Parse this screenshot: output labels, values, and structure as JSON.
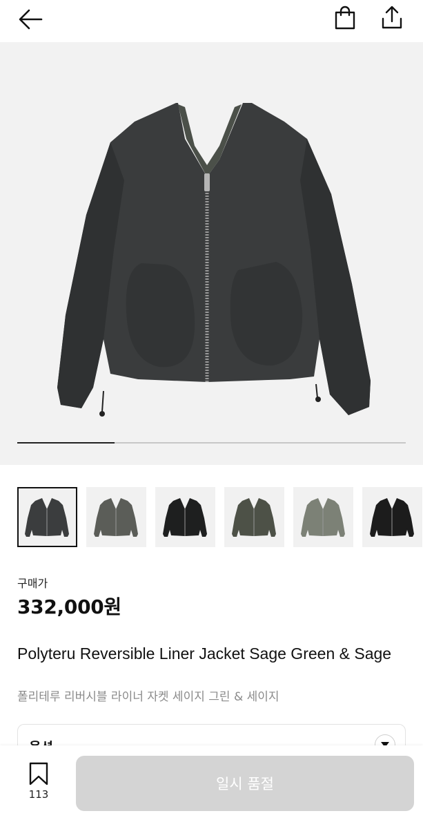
{
  "header": {
    "back_icon": "arrow-left-icon",
    "bag_icon": "shopping-bag-icon",
    "share_icon": "share-icon"
  },
  "gallery": {
    "progress": 0.25,
    "thumbnails": [
      {
        "name": "thumbnail-1",
        "selected": true,
        "jacket_color": "#3b3d3e"
      },
      {
        "name": "thumbnail-2",
        "selected": false,
        "jacket_color": "#5b5d58"
      },
      {
        "name": "thumbnail-3",
        "selected": false,
        "jacket_color": "#1e1f1f"
      },
      {
        "name": "thumbnail-4",
        "selected": false,
        "jacket_color": "#4d5147"
      },
      {
        "name": "thumbnail-5",
        "selected": false,
        "jacket_color": "#7c8176"
      },
      {
        "name": "thumbnail-6",
        "selected": false,
        "jacket_color": "#1c1c1c"
      }
    ]
  },
  "product": {
    "price_label": "구매가",
    "price": "332,000원",
    "title_en": "Polyteru Reversible Liner Jacket Sage Green & Sage",
    "title_ko": "폴리테루 리버시블 라이너 자켓 세이지 그린 & 세이지"
  },
  "options": {
    "label": "옵션",
    "toggle_icon": "triangle-down-icon"
  },
  "bottom_bar": {
    "bookmark_icon": "bookmark-icon",
    "bookmark_count": "113",
    "action_label": "일시 품절"
  },
  "colors": {
    "accent": "#111111",
    "disabled_button": "#d4d4d4",
    "hero_background": "#f2f2f2",
    "subtitle_gray": "#8a8a8a"
  }
}
